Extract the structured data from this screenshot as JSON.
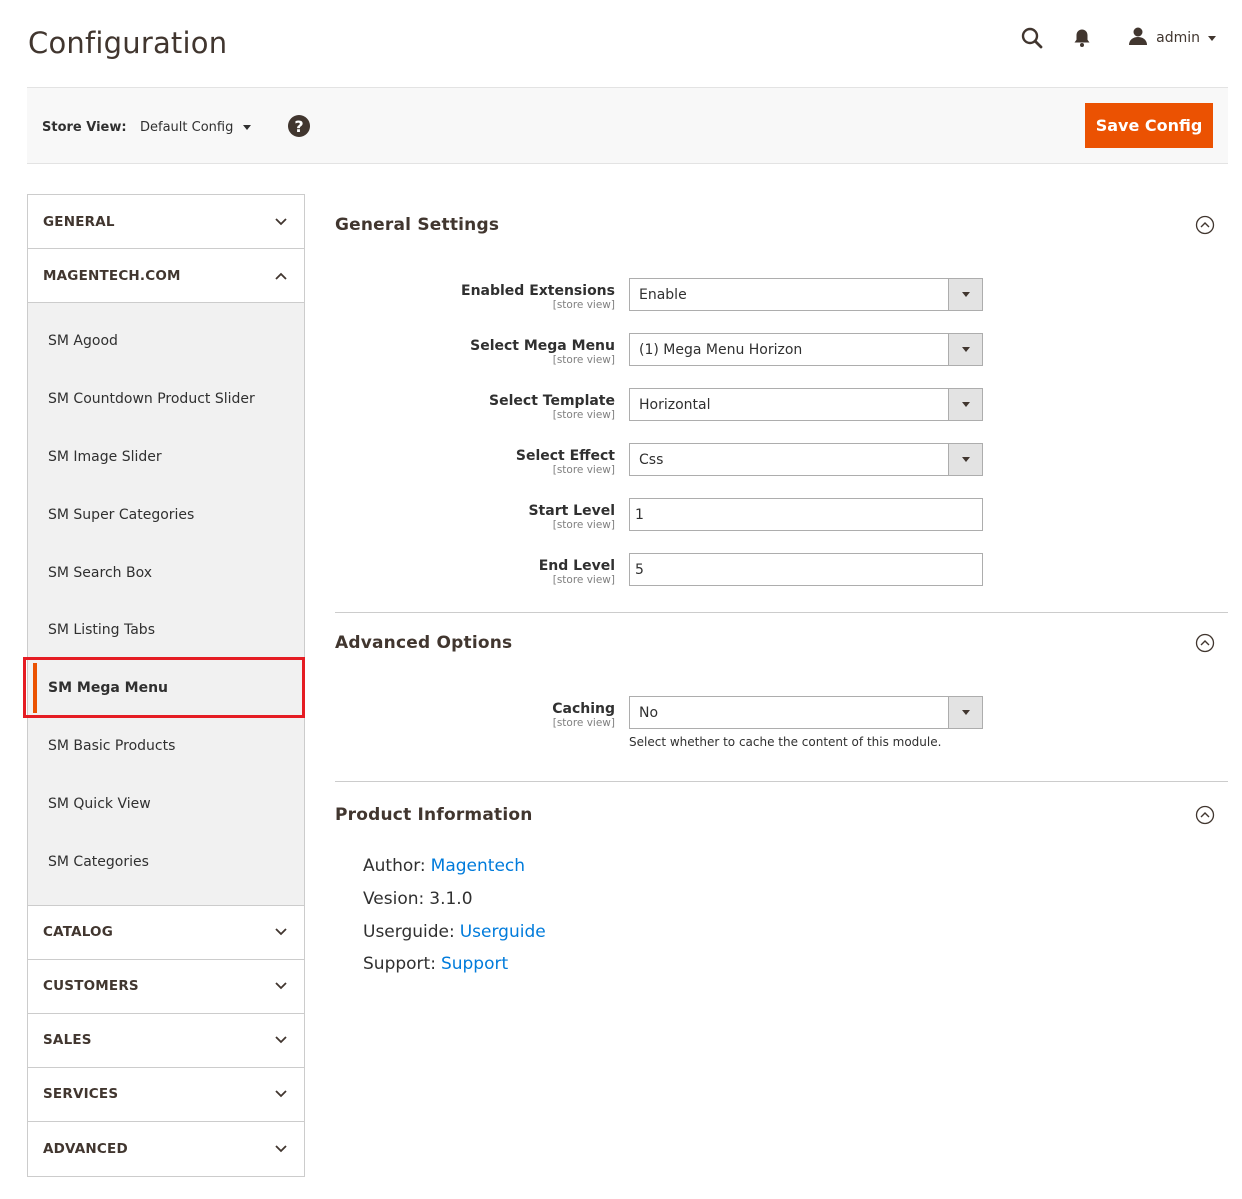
{
  "header": {
    "title": "Configuration",
    "user_name": "admin"
  },
  "store_bar": {
    "label": "Store View:",
    "selected": "Default Config",
    "help": "?",
    "save_label": "Save Config"
  },
  "sidebar": {
    "general": "GENERAL",
    "magentech": "MAGENTECH.COM",
    "sub_items": [
      "SM Agood",
      "SM Countdown Product Slider",
      "SM Image Slider",
      "SM Super Categories",
      "SM Search Box",
      "SM Listing Tabs",
      "SM Mega Menu",
      "SM Basic Products",
      "SM Quick View",
      "SM Categories"
    ],
    "catalog": "CATALOG",
    "customers": "CUSTOMERS",
    "sales": "SALES",
    "services": "SERVICES",
    "advanced": "ADVANCED"
  },
  "general_settings": {
    "title": "General Settings",
    "fields": [
      {
        "label": "Enabled Extensions",
        "scope": "[store view]",
        "value": "Enable"
      },
      {
        "label": "Select Mega Menu",
        "scope": "[store view]",
        "value": "(1) Mega Menu Horizon"
      },
      {
        "label": "Select Template",
        "scope": "[store view]",
        "value": "Horizontal"
      },
      {
        "label": "Select Effect",
        "scope": "[store view]",
        "value": "Css"
      },
      {
        "label": "Start Level",
        "scope": "[store view]",
        "value": "1"
      },
      {
        "label": "End Level",
        "scope": "[store view]",
        "value": "5"
      }
    ]
  },
  "advanced_options": {
    "title": "Advanced Options",
    "caching": {
      "label": "Caching",
      "scope": "[store view]",
      "value": "No",
      "note": "Select whether to cache the content of this module."
    }
  },
  "product_information": {
    "title": "Product Information",
    "author_key": "Author:",
    "author_val": "Magentech",
    "version_key": "Vesion:",
    "version_val": "3.1.0",
    "userguide_key": "Userguide:",
    "userguide_val": "Userguide",
    "support_key": "Support:",
    "support_val": "Support"
  },
  "colors": {
    "accent": "#eb5202",
    "highlight": "#e51c23",
    "link": "#007bdb"
  }
}
